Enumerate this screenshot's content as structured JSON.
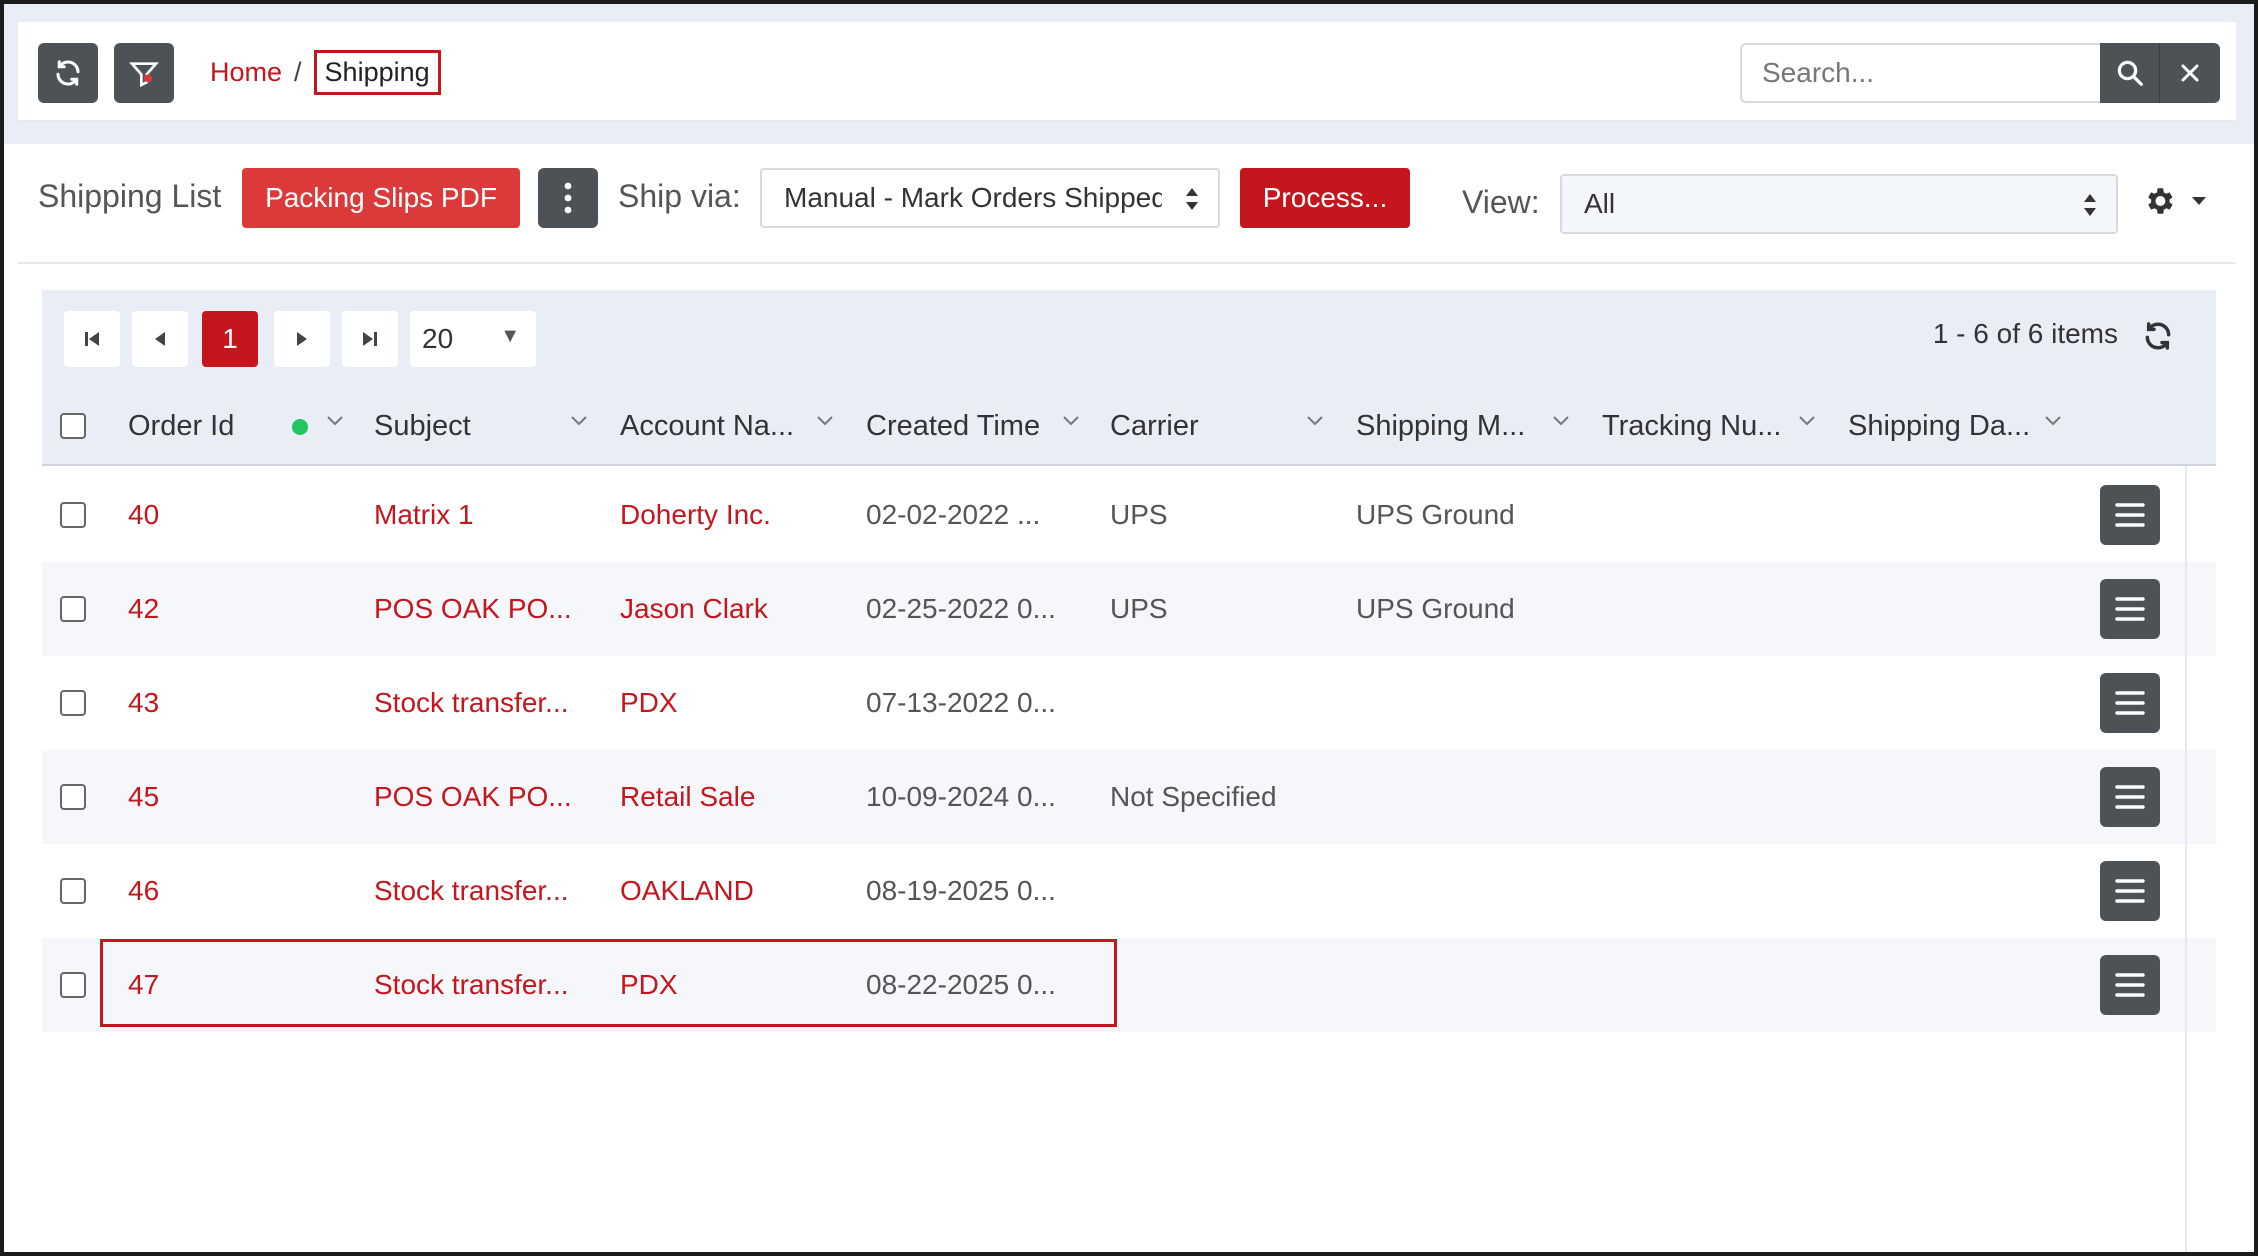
{
  "header": {
    "breadcrumb": {
      "home": "Home",
      "separator": "/",
      "current": "Shipping"
    },
    "search": {
      "placeholder": "Search..."
    },
    "icons": {
      "refresh": "refresh-icon",
      "filter": "filter-icon",
      "search": "search-icon",
      "clear": "close-icon"
    }
  },
  "toolbar": {
    "list_label": "Shipping List",
    "packing_slips_label": "Packing Slips PDF",
    "ship_via_label": "Ship via:",
    "ship_via_value": "Manual - Mark Orders Shipped",
    "process_label": "Process...",
    "view_label": "View:",
    "view_value": "All"
  },
  "pager": {
    "current_page": "1",
    "page_size": "20",
    "info": "1 - 6 of 6 items"
  },
  "columns": [
    "Order Id",
    "Subject",
    "Account Na...",
    "Created Time",
    "Carrier",
    "Shipping M...",
    "Tracking Nu...",
    "Shipping Da..."
  ],
  "rows": [
    {
      "order_id": "40",
      "subject": "Matrix 1",
      "account": "Doherty Inc.",
      "created": "02-02-2022 ...",
      "carrier": "UPS",
      "shipping_method": "UPS Ground",
      "tracking": "",
      "ship_date": ""
    },
    {
      "order_id": "42",
      "subject": "POS OAK PO...",
      "account": "Jason Clark",
      "created": "02-25-2022 0...",
      "carrier": "UPS",
      "shipping_method": "UPS Ground",
      "tracking": "",
      "ship_date": ""
    },
    {
      "order_id": "43",
      "subject": "Stock transfer...",
      "account": "PDX",
      "created": "07-13-2022 0...",
      "carrier": "",
      "shipping_method": "",
      "tracking": "",
      "ship_date": ""
    },
    {
      "order_id": "45",
      "subject": "POS OAK PO...",
      "account": "Retail Sale",
      "created": "10-09-2024 0...",
      "carrier": "Not Specified",
      "shipping_method": "",
      "tracking": "",
      "ship_date": ""
    },
    {
      "order_id": "46",
      "subject": "Stock transfer...",
      "account": "OAKLAND",
      "created": "08-19-2025 0...",
      "carrier": "",
      "shipping_method": "",
      "tracking": "",
      "ship_date": ""
    },
    {
      "order_id": "47",
      "subject": "Stock transfer...",
      "account": "PDX",
      "created": "08-22-2025 0...",
      "carrier": "",
      "shipping_method": "",
      "tracking": "",
      "ship_date": ""
    }
  ],
  "colors": {
    "accent": "#c4161c",
    "button_red": "#dc3a3a",
    "dark_button": "#4d5257",
    "panel": "#e8edf6",
    "status_dot": "#22c55e"
  }
}
